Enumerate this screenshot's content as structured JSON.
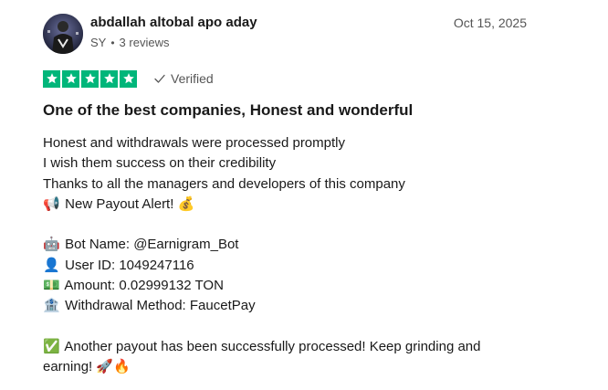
{
  "review": {
    "author": {
      "name": "abdallah altobal apo aday",
      "country": "SY",
      "reviews": "3 reviews"
    },
    "date": "Oct 15, 2025",
    "rating": 5,
    "rating_max": 5,
    "verified_label": "Verified",
    "title": "One of the best companies, Honest and wonderful",
    "body": {
      "line1": "Honest and withdrawals were processed promptly",
      "line2": "I wish them success on their credibility",
      "line3": "Thanks to all the managers and developers of this company",
      "alert_icon": "📢",
      "alert_text": "New Payout Alert!",
      "alert_icon2": "💰",
      "bot_icon": "🤖",
      "bot_text": "Bot Name: @Earnigram_Bot",
      "user_icon": "👤",
      "user_text": "User ID: 1049247116",
      "amount_icon": "💵",
      "amount_text": "Amount: 0.02999132 TON",
      "method_icon": "🏦",
      "method_text": "Withdrawal Method: FaucetPay",
      "final_icon": "✅",
      "final_text": "Another payout has been successfully processed! Keep grinding and earning!",
      "final_icons": "🚀🔥"
    }
  },
  "colors": {
    "star_green": "#00b67a",
    "text_primary": "#191919",
    "text_secondary": "#555555"
  },
  "icons": {
    "star": "star-icon",
    "verified": "checkmark-icon"
  }
}
